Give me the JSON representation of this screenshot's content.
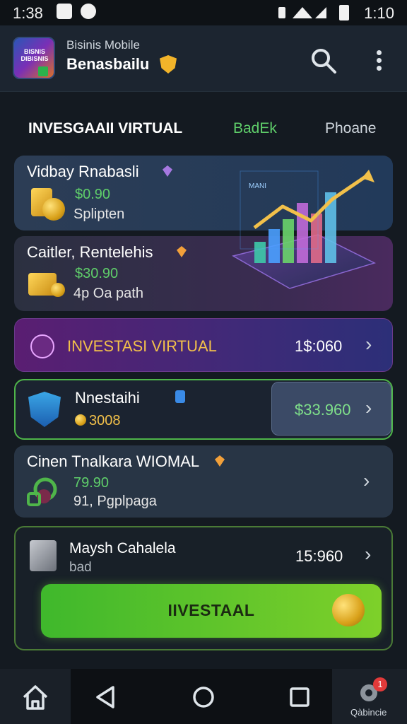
{
  "status_bar": {
    "time": "1:38",
    "right_time": "1:10"
  },
  "header": {
    "subtitle": "Bisinis Mobile",
    "title": "Benasbailu",
    "logo_text": "BISNIS DIBISNIS"
  },
  "tabs": [
    {
      "label": "INVESGAAII VIRTUAL"
    },
    {
      "label": "BadEk"
    },
    {
      "label": "Phoane"
    }
  ],
  "cards": {
    "card1": {
      "title": "Vidbay Rnabasli",
      "value": "$0.90",
      "sub": "Splipten"
    },
    "card2": {
      "title": "Caitler, Rentelehis",
      "value": "$30.90",
      "sub": "4p Oa path"
    },
    "banner": {
      "label": "INVESTASI VIRTUAL",
      "value": "1$:060"
    },
    "card4": {
      "title": "Nnestaihi",
      "value": "3008",
      "button_value": "$33.960"
    },
    "card5": {
      "title": "Cinen Tnalkara WIOMAL",
      "value": "79.90",
      "sub": "91, Pgplpaga"
    },
    "card6": {
      "title": "Maysh Cahalela",
      "sub": "bad",
      "value": "15:960",
      "cta": "IIVESTAAL"
    }
  },
  "chart_illustration": {
    "label": "MANI",
    "bars": [
      30,
      48,
      62,
      85,
      70,
      100
    ]
  },
  "nav": {
    "label": "Qàbincie",
    "badge": "1"
  },
  "colors": {
    "accent_green": "#5fce6a",
    "gold": "#f2c04a",
    "purple": "#5a1e72"
  }
}
